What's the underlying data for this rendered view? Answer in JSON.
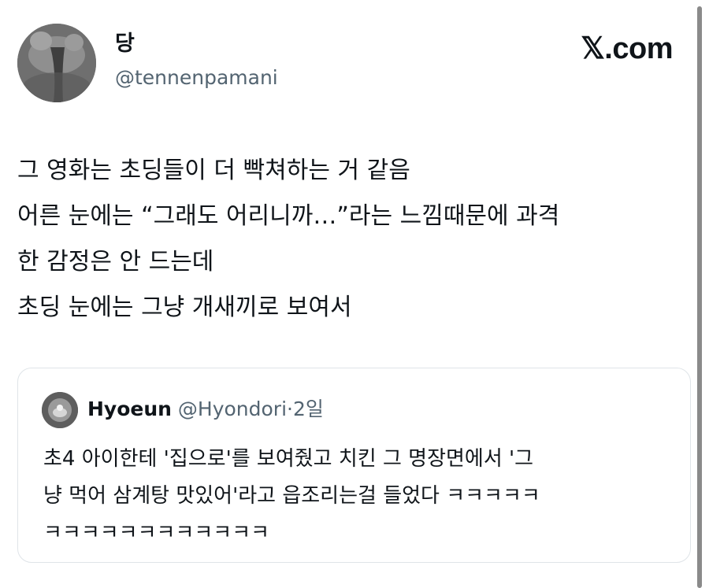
{
  "tweet": {
    "author": {
      "name": "당",
      "handle": "@tennenpamani"
    },
    "source": "𝕏.com",
    "lines": [
      "그 영화는 초딩들이 더 빡쳐하는 거 같음",
      "어른 눈에는 “그래도 어리니까…”라는 느낌때문에 과격",
      "한 감정은 안 드는데",
      "초딩 눈에는 그냥 개새끼로 보여서"
    ]
  },
  "quote": {
    "name": "Hyoeun",
    "handle": "@Hyondori",
    "separator": "·",
    "time": "2일",
    "lines": [
      "초4 아이한테 '집으로'를 보여줬고 치킨 그 명장면에서 '그",
      "냥 먹어 삼계탕 맛있어'라고 읍조리는걸 들었다 ㅋㅋㅋㅋㅋ",
      "ㅋㅋㅋㅋㅋㅋㅋㅋㅋㅋㅋㅋ"
    ]
  },
  "icons": {
    "author_avatar": "profile-photo-icon",
    "quote_avatar": "profile-photo-icon"
  },
  "colors": {
    "text": "#0f1419",
    "secondary": "#536471",
    "border": "#dfe4e8"
  }
}
